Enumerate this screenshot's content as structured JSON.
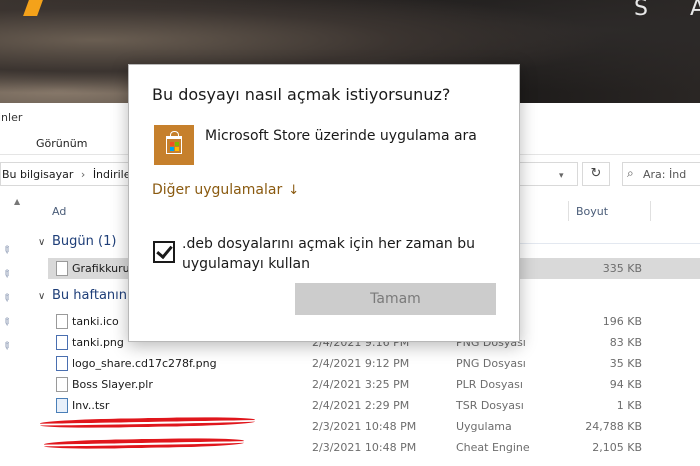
{
  "wallpaper": {
    "letter_s": "S",
    "letter_a": "A"
  },
  "explorer": {
    "title_fragment": "inler",
    "ribbon": {
      "view_tab": "Görünüm"
    },
    "address": {
      "path_part1": "Bu bilgisayar",
      "separator": "›",
      "path_part2": "İndirilen"
    },
    "search": {
      "placeholder": "Ara: İnd"
    },
    "columns": {
      "name": "Ad",
      "size": "Boyut"
    },
    "groups": {
      "today": "Bugün (1)",
      "this_week": "Bu haftanın"
    },
    "today_files": [
      {
        "name": "Grafikkuru",
        "size": "335 KB"
      }
    ],
    "week_files": [
      {
        "name": "tanki.ico",
        "date": "",
        "type": "",
        "size": "196 KB"
      },
      {
        "name": "tanki.png",
        "date": "2/4/2021 9:16 PM",
        "type": "PNG Dosyası",
        "size": "83 KB"
      },
      {
        "name": "logo_share.cd17c278f.png",
        "date": "2/4/2021 9:12 PM",
        "type": "PNG Dosyası",
        "size": "35 KB"
      },
      {
        "name": "Boss Slayer.plr",
        "date": "2/4/2021 3:25 PM",
        "type": "PLR Dosyası",
        "size": "94 KB"
      },
      {
        "name": "Inv..tsr",
        "date": "2/4/2021 2:29 PM",
        "type": "TSR Dosyası",
        "size": "1 KB"
      },
      {
        "name": "",
        "date": "2/3/2021 10:48 PM",
        "type": "Uygulama",
        "size": "24,788 KB"
      },
      {
        "name": "",
        "date": "2/3/2021 10:48 PM",
        "type": "Cheat Engine",
        "size": "2,105 KB"
      }
    ]
  },
  "dialog": {
    "title": "Bu dosyayı nasıl açmak istiyorsunuz?",
    "store_option": "Microsoft Store üzerinde uygulama ara",
    "other_apps": "Diğer uygulamalar",
    "other_apps_arrow": "↓",
    "always_use_label": ".deb dosyalarını açmak için her zaman bu uygulamayı kullan",
    "always_use_checked": true,
    "ok_button": "Tamam",
    "colors": {
      "accent_link": "#8a5a10",
      "store_tile": "#c6802c",
      "ok_disabled": "#cccccc"
    }
  }
}
